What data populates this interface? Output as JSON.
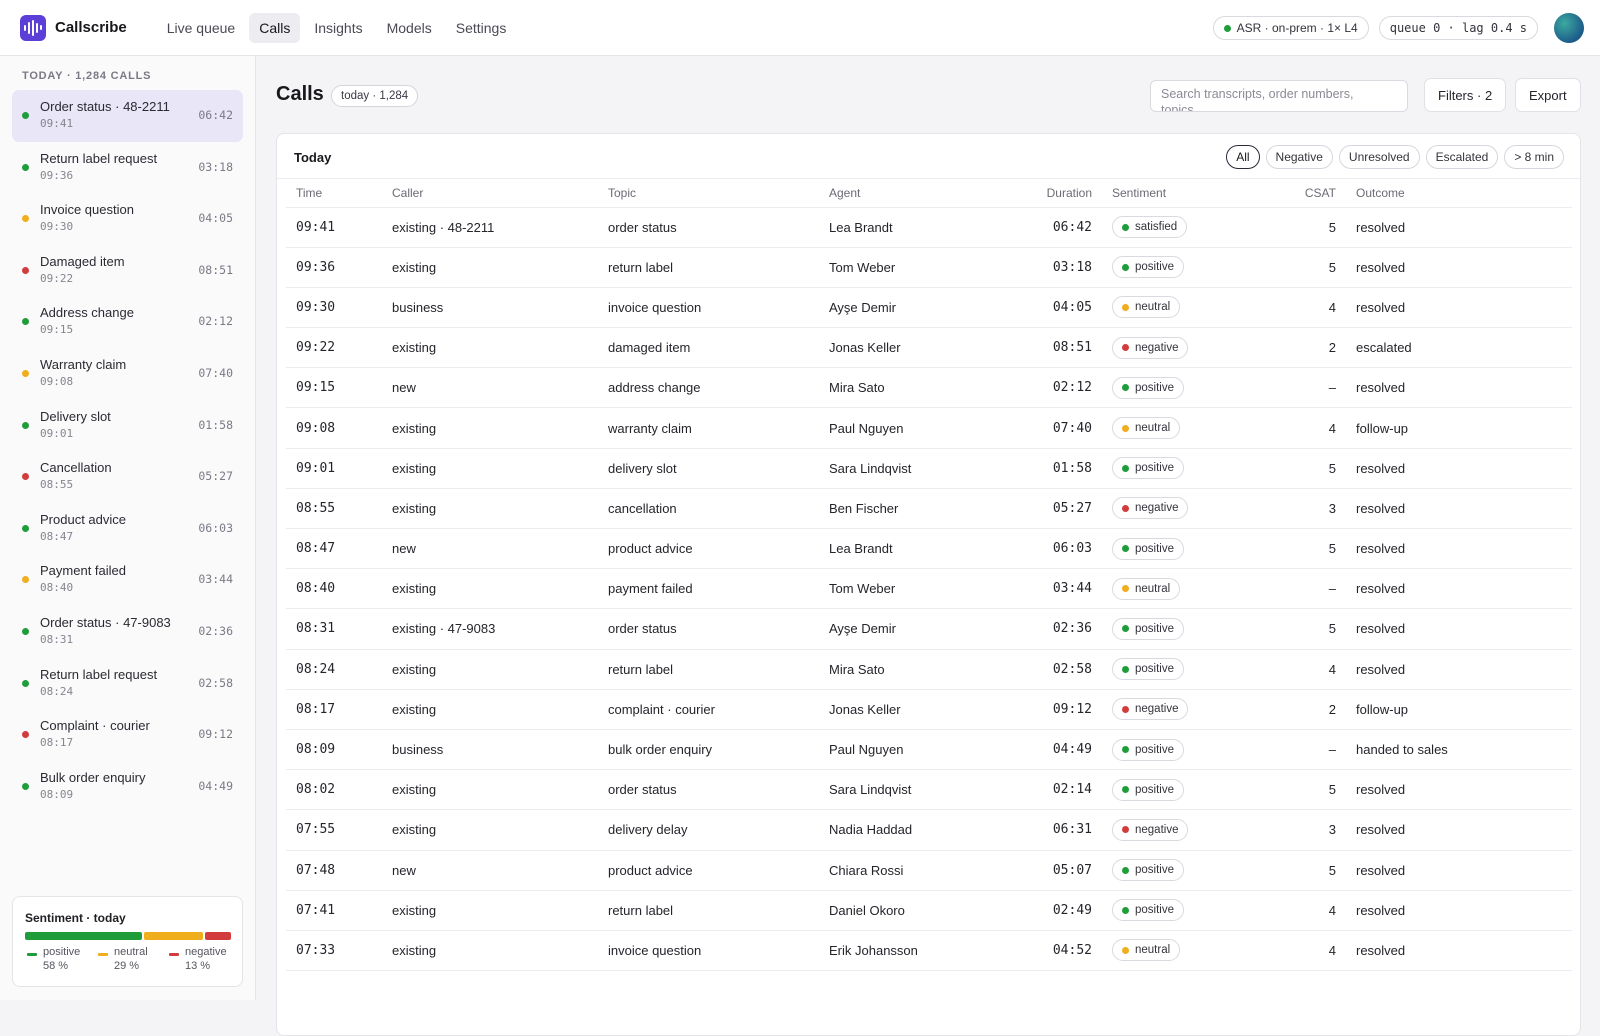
{
  "app": {
    "name": "Callscribe",
    "nav": [
      {
        "label": "Live queue",
        "active": false
      },
      {
        "label": "Calls",
        "active": true
      },
      {
        "label": "Insights",
        "active": false
      },
      {
        "label": "Models",
        "active": false
      },
      {
        "label": "Settings",
        "active": false
      }
    ],
    "asr_status": "ASR · on-prem · 1× L4",
    "queue_status": "queue 0 · lag 0.4 s"
  },
  "colors": {
    "positive": "#1f9d3a",
    "neutral": "#f0ad1c",
    "negative": "#d23c3c",
    "accent": "#5b3fd6"
  },
  "sidebar": {
    "heading": "TODAY · 1,284 CALLS",
    "items": [
      {
        "title": "Order status · 48-2211",
        "time": "09:41",
        "duration": "06:42",
        "sentiment": "positive",
        "active": true
      },
      {
        "title": "Return label request",
        "time": "09:36",
        "duration": "03:18",
        "sentiment": "positive"
      },
      {
        "title": "Invoice question",
        "time": "09:30",
        "duration": "04:05",
        "sentiment": "neutral"
      },
      {
        "title": "Damaged item",
        "time": "09:22",
        "duration": "08:51",
        "sentiment": "negative"
      },
      {
        "title": "Address change",
        "time": "09:15",
        "duration": "02:12",
        "sentiment": "positive"
      },
      {
        "title": "Warranty claim",
        "time": "09:08",
        "duration": "07:40",
        "sentiment": "neutral"
      },
      {
        "title": "Delivery slot",
        "time": "09:01",
        "duration": "01:58",
        "sentiment": "positive"
      },
      {
        "title": "Cancellation",
        "time": "08:55",
        "duration": "05:27",
        "sentiment": "negative"
      },
      {
        "title": "Product advice",
        "time": "08:47",
        "duration": "06:03",
        "sentiment": "positive"
      },
      {
        "title": "Payment failed",
        "time": "08:40",
        "duration": "03:44",
        "sentiment": "neutral"
      },
      {
        "title": "Order status · 47-9083",
        "time": "08:31",
        "duration": "02:36",
        "sentiment": "positive"
      },
      {
        "title": "Return label request",
        "time": "08:24",
        "duration": "02:58",
        "sentiment": "positive"
      },
      {
        "title": "Complaint · courier",
        "time": "08:17",
        "duration": "09:12",
        "sentiment": "negative"
      },
      {
        "title": "Bulk order enquiry",
        "time": "08:09",
        "duration": "04:49",
        "sentiment": "positive"
      }
    ],
    "sentiment_summary": {
      "title": "Sentiment · today",
      "segments": [
        {
          "label": "positive",
          "value_text": "58 %",
          "percent": 58,
          "sentiment": "positive"
        },
        {
          "label": "neutral",
          "value_text": "29 %",
          "percent": 29,
          "sentiment": "neutral"
        },
        {
          "label": "negative",
          "value_text": "13 %",
          "percent": 13,
          "sentiment": "negative"
        }
      ]
    }
  },
  "main": {
    "title": "Calls",
    "count_badge": "today · 1,284",
    "search_placeholder": "Search transcripts, order numbers, topics…",
    "filters_label": "Filters · 2",
    "export_label": "Export",
    "card_title": "Today",
    "chips": [
      {
        "label": "All",
        "active": true
      },
      {
        "label": "Negative",
        "active": false
      },
      {
        "label": "Unresolved",
        "active": false
      },
      {
        "label": "Escalated",
        "active": false
      },
      {
        "label": "> 8 min",
        "active": false
      }
    ],
    "columns": [
      "Time",
      "Caller",
      "Topic",
      "Agent",
      "Duration",
      "Sentiment",
      "CSAT",
      "Outcome"
    ],
    "rows": [
      {
        "time": "09:41",
        "caller": "existing · 48-2211",
        "topic": "order status",
        "agent": "Lea Brandt",
        "duration": "06:42",
        "sentiment": "satisfied",
        "tone": "positive",
        "csat": "5",
        "outcome": "resolved"
      },
      {
        "time": "09:36",
        "caller": "existing",
        "topic": "return label",
        "agent": "Tom Weber",
        "duration": "03:18",
        "sentiment": "positive",
        "tone": "positive",
        "csat": "5",
        "outcome": "resolved"
      },
      {
        "time": "09:30",
        "caller": "business",
        "topic": "invoice question",
        "agent": "Ayşe Demir",
        "duration": "04:05",
        "sentiment": "neutral",
        "tone": "neutral",
        "csat": "4",
        "outcome": "resolved"
      },
      {
        "time": "09:22",
        "caller": "existing",
        "topic": "damaged item",
        "agent": "Jonas Keller",
        "duration": "08:51",
        "sentiment": "negative",
        "tone": "negative",
        "csat": "2",
        "outcome": "escalated"
      },
      {
        "time": "09:15",
        "caller": "new",
        "topic": "address change",
        "agent": "Mira Sato",
        "duration": "02:12",
        "sentiment": "positive",
        "tone": "positive",
        "csat": "–",
        "outcome": "resolved"
      },
      {
        "time": "09:08",
        "caller": "existing",
        "topic": "warranty claim",
        "agent": "Paul Nguyen",
        "duration": "07:40",
        "sentiment": "neutral",
        "tone": "neutral",
        "csat": "4",
        "outcome": "follow-up"
      },
      {
        "time": "09:01",
        "caller": "existing",
        "topic": "delivery slot",
        "agent": "Sara Lindqvist",
        "duration": "01:58",
        "sentiment": "positive",
        "tone": "positive",
        "csat": "5",
        "outcome": "resolved"
      },
      {
        "time": "08:55",
        "caller": "existing",
        "topic": "cancellation",
        "agent": "Ben Fischer",
        "duration": "05:27",
        "sentiment": "negative",
        "tone": "negative",
        "csat": "3",
        "outcome": "resolved"
      },
      {
        "time": "08:47",
        "caller": "new",
        "topic": "product advice",
        "agent": "Lea Brandt",
        "duration": "06:03",
        "sentiment": "positive",
        "tone": "positive",
        "csat": "5",
        "outcome": "resolved"
      },
      {
        "time": "08:40",
        "caller": "existing",
        "topic": "payment failed",
        "agent": "Tom Weber",
        "duration": "03:44",
        "sentiment": "neutral",
        "tone": "neutral",
        "csat": "–",
        "outcome": "resolved"
      },
      {
        "time": "08:31",
        "caller": "existing · 47-9083",
        "topic": "order status",
        "agent": "Ayşe Demir",
        "duration": "02:36",
        "sentiment": "positive",
        "tone": "positive",
        "csat": "5",
        "outcome": "resolved"
      },
      {
        "time": "08:24",
        "caller": "existing",
        "topic": "return label",
        "agent": "Mira Sato",
        "duration": "02:58",
        "sentiment": "positive",
        "tone": "positive",
        "csat": "4",
        "outcome": "resolved"
      },
      {
        "time": "08:17",
        "caller": "existing",
        "topic": "complaint · courier",
        "agent": "Jonas Keller",
        "duration": "09:12",
        "sentiment": "negative",
        "tone": "negative",
        "csat": "2",
        "outcome": "follow-up"
      },
      {
        "time": "08:09",
        "caller": "business",
        "topic": "bulk order enquiry",
        "agent": "Paul Nguyen",
        "duration": "04:49",
        "sentiment": "positive",
        "tone": "positive",
        "csat": "–",
        "outcome": "handed to sales"
      },
      {
        "time": "08:02",
        "caller": "existing",
        "topic": "order status",
        "agent": "Sara Lindqvist",
        "duration": "02:14",
        "sentiment": "positive",
        "tone": "positive",
        "csat": "5",
        "outcome": "resolved"
      },
      {
        "time": "07:55",
        "caller": "existing",
        "topic": "delivery delay",
        "agent": "Nadia Haddad",
        "duration": "06:31",
        "sentiment": "negative",
        "tone": "negative",
        "csat": "3",
        "outcome": "resolved"
      },
      {
        "time": "07:48",
        "caller": "new",
        "topic": "product advice",
        "agent": "Chiara Rossi",
        "duration": "05:07",
        "sentiment": "positive",
        "tone": "positive",
        "csat": "5",
        "outcome": "resolved"
      },
      {
        "time": "07:41",
        "caller": "existing",
        "topic": "return label",
        "agent": "Daniel Okoro",
        "duration": "02:49",
        "sentiment": "positive",
        "tone": "positive",
        "csat": "4",
        "outcome": "resolved"
      },
      {
        "time": "07:33",
        "caller": "existing",
        "topic": "invoice question",
        "agent": "Erik Johansson",
        "duration": "04:52",
        "sentiment": "neutral",
        "tone": "neutral",
        "csat": "4",
        "outcome": "resolved"
      }
    ]
  }
}
